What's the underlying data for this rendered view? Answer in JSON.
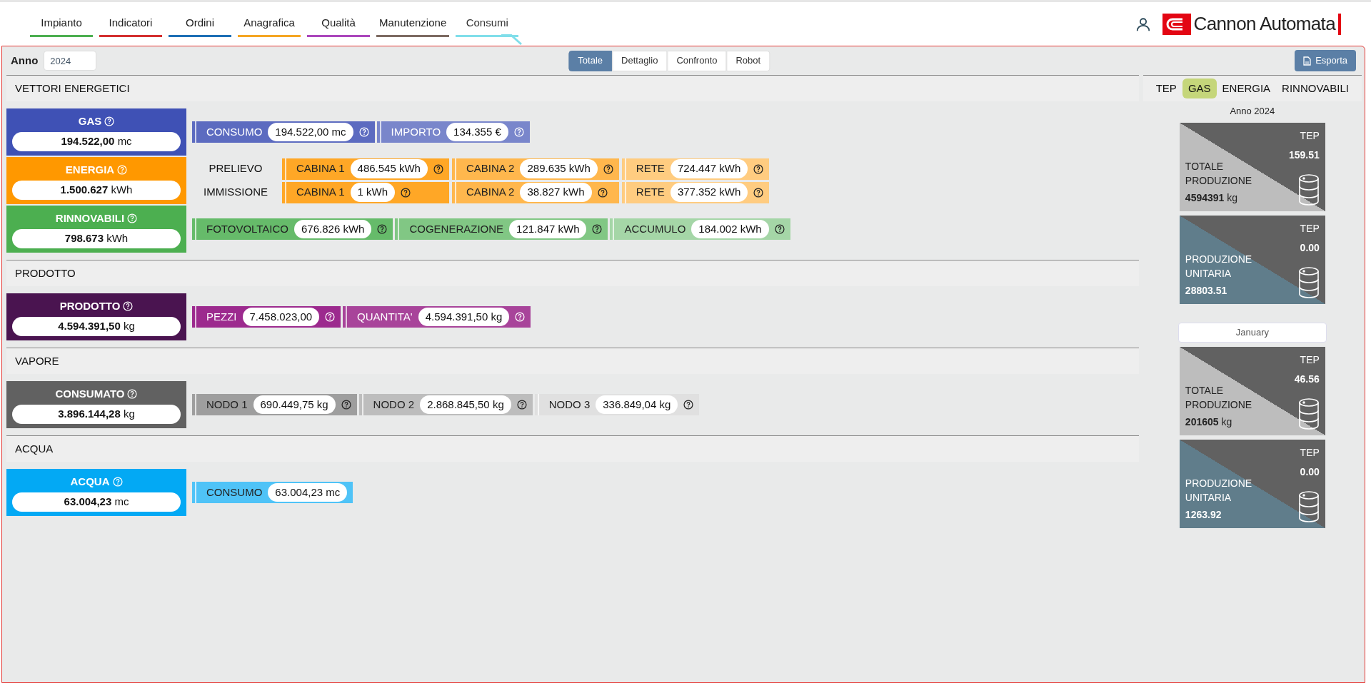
{
  "nav": {
    "tabs": [
      {
        "label": "Impianto",
        "color": "#4caf50",
        "selected": false
      },
      {
        "label": "Indicatori",
        "color": "#d32f2f",
        "selected": false
      },
      {
        "label": "Ordini",
        "color": "#1e6fb5",
        "selected": false
      },
      {
        "label": "Anagrafica",
        "color": "#f5a623",
        "selected": false
      },
      {
        "label": "Qualità",
        "color": "#ab47bc",
        "selected": false
      },
      {
        "label": "Manutenzione",
        "color": "#7d6a62",
        "selected": false
      },
      {
        "label": "Consumi",
        "color": "#80deea",
        "selected": true
      }
    ],
    "brand": "Cannon Automata"
  },
  "toolbar": {
    "year_label": "Anno",
    "year_value": "2024",
    "views": [
      {
        "label": "Totale",
        "selected": true
      },
      {
        "label": "Dettaglio",
        "selected": false
      },
      {
        "label": "Confronto",
        "selected": false
      },
      {
        "label": "Robot",
        "selected": false
      }
    ],
    "export": "Esporta"
  },
  "sections": [
    {
      "title": "VETTORI ENERGETICI",
      "cards": [
        {
          "label": "GAS",
          "value": "194.522,00",
          "unit": "mc",
          "color": "#3f51b5",
          "rows": [
            {
              "items": [
                {
                  "label": "CONSUMO",
                  "value": "194.522,00 mc",
                  "color": "#5c6bc0",
                  "help": true
                },
                {
                  "label": "IMPORTO",
                  "value": "134.355 €",
                  "color": "#7986cb",
                  "help": true
                }
              ]
            }
          ]
        },
        {
          "label": "ENERGIA",
          "value": "1.500.627",
          "unit": "kWh",
          "color": "#ff9800",
          "rows": [
            {
              "label": "PRELIEVO",
              "items": [
                {
                  "label": "CABINA 1",
                  "value": "486.545 kWh",
                  "color": "#ffa726",
                  "help": true
                },
                {
                  "label": "CABINA 2",
                  "value": "289.635 kWh",
                  "color": "#ffb74d",
                  "help": true
                },
                {
                  "label": "RETE",
                  "value": "724.447 kWh",
                  "color": "#ffcc80",
                  "help": true
                }
              ]
            },
            {
              "label": "IMMISSIONE",
              "items": [
                {
                  "label": "CABINA 1",
                  "value": "1 kWh",
                  "color": "#ffa726",
                  "help": true
                },
                {
                  "label": "CABINA 2",
                  "value": "38.827 kWh",
                  "color": "#ffb74d",
                  "help": true
                },
                {
                  "label": "RETE",
                  "value": "377.352 kWh",
                  "color": "#ffcc80",
                  "help": true
                }
              ]
            }
          ]
        },
        {
          "label": "RINNOVABILI",
          "value": "798.673",
          "unit": "kWh",
          "color": "#4caf50",
          "rows": [
            {
              "items": [
                {
                  "label": "FOTOVOLTAICO",
                  "value": "676.826 kWh",
                  "color": "#66bb6a",
                  "help": true
                },
                {
                  "label": "COGENERAZIONE",
                  "value": "121.847 kWh",
                  "color": "#81c784",
                  "help": true
                },
                {
                  "label": "ACCUMULO",
                  "value": "184.002 kWh",
                  "color": "#a5d6a7",
                  "help": true
                }
              ]
            }
          ]
        }
      ]
    },
    {
      "title": "PRODOTTO",
      "cards": [
        {
          "label": "PRODOTTO",
          "value": "4.594.391,50",
          "unit": "kg",
          "color": "#4a1450",
          "rows": [
            {
              "items": [
                {
                  "label": "PEZZI",
                  "value": "7.458.023,00",
                  "color": "#9c2a8e",
                  "help": true
                },
                {
                  "label": "QUANTITA'",
                  "value": "4.594.391,50 kg",
                  "color": "#a8449a",
                  "help": true
                }
              ]
            }
          ]
        }
      ]
    },
    {
      "title": "VAPORE",
      "cards": [
        {
          "label": "CONSUMATO",
          "value": "3.896.144,28",
          "unit": "kg",
          "color": "#616161",
          "rows": [
            {
              "items": [
                {
                  "label": "NODO 1",
                  "value": "690.449,75 kg",
                  "color": "#9e9e9e",
                  "help": true
                },
                {
                  "label": "NODO 2",
                  "value": "2.868.845,50 kg",
                  "color": "#bdbdbd",
                  "help": true
                },
                {
                  "label": "NODO 3",
                  "value": "336.849,04 kg",
                  "color": "#e0e0e0",
                  "help": true
                }
              ]
            }
          ]
        }
      ]
    },
    {
      "title": "ACQUA",
      "cards": [
        {
          "label": "ACQUA",
          "value": "63.004,23",
          "unit": "mc",
          "color": "#03a9f4",
          "rows": [
            {
              "items": [
                {
                  "label": "CONSUMO",
                  "value": "63.004,23 mc",
                  "color": "#4fc3f7",
                  "help": false
                }
              ]
            }
          ]
        }
      ]
    }
  ],
  "side": {
    "tabs": [
      {
        "label": "TEP",
        "selected": false
      },
      {
        "label": "GAS",
        "selected": true
      },
      {
        "label": "ENERGIA",
        "selected": false
      },
      {
        "label": "RINNOVABILI",
        "selected": false
      }
    ],
    "groups": [
      {
        "kind": "caption",
        "caption": "Anno 2024",
        "tiles": [
          {
            "kind": "totale",
            "label": "TOTALE PRODUZIONE",
            "value": "4594391",
            "unit": "kg",
            "tep_label": "TEP",
            "tep_value": "159.51"
          },
          {
            "kind": "unitaria",
            "label": "PRODUZIONE UNITARIA",
            "value": "28803.51",
            "tep_label": "TEP",
            "tep_value": "0.00"
          }
        ]
      },
      {
        "kind": "select",
        "caption": "January",
        "tiles": [
          {
            "kind": "totale",
            "label": "TOTALE PRODUZIONE",
            "value": "201605",
            "unit": "kg",
            "tep_label": "TEP",
            "tep_value": "46.56"
          },
          {
            "kind": "unitaria",
            "label": "PRODUZIONE UNITARIA",
            "value": "1263.92",
            "tep_label": "TEP",
            "tep_value": "0.00"
          }
        ]
      }
    ]
  }
}
